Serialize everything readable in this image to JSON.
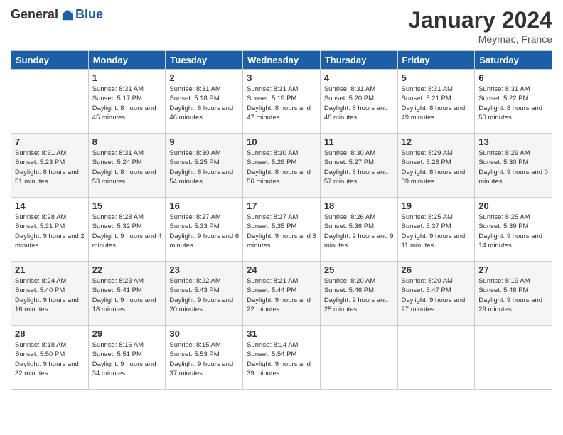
{
  "header": {
    "logo_general": "General",
    "logo_blue": "Blue",
    "month_title": "January 2024",
    "location": "Meymac, France"
  },
  "days_of_week": [
    "Sunday",
    "Monday",
    "Tuesday",
    "Wednesday",
    "Thursday",
    "Friday",
    "Saturday"
  ],
  "weeks": [
    [
      {
        "day": "",
        "sunrise": "",
        "sunset": "",
        "daylight": ""
      },
      {
        "day": "1",
        "sunrise": "Sunrise: 8:31 AM",
        "sunset": "Sunset: 5:17 PM",
        "daylight": "Daylight: 8 hours and 45 minutes."
      },
      {
        "day": "2",
        "sunrise": "Sunrise: 8:31 AM",
        "sunset": "Sunset: 5:18 PM",
        "daylight": "Daylight: 8 hours and 46 minutes."
      },
      {
        "day": "3",
        "sunrise": "Sunrise: 8:31 AM",
        "sunset": "Sunset: 5:19 PM",
        "daylight": "Daylight: 8 hours and 47 minutes."
      },
      {
        "day": "4",
        "sunrise": "Sunrise: 8:31 AM",
        "sunset": "Sunset: 5:20 PM",
        "daylight": "Daylight: 8 hours and 48 minutes."
      },
      {
        "day": "5",
        "sunrise": "Sunrise: 8:31 AM",
        "sunset": "Sunset: 5:21 PM",
        "daylight": "Daylight: 8 hours and 49 minutes."
      },
      {
        "day": "6",
        "sunrise": "Sunrise: 8:31 AM",
        "sunset": "Sunset: 5:22 PM",
        "daylight": "Daylight: 8 hours and 50 minutes."
      }
    ],
    [
      {
        "day": "7",
        "sunrise": "Sunrise: 8:31 AM",
        "sunset": "Sunset: 5:23 PM",
        "daylight": "Daylight: 8 hours and 51 minutes."
      },
      {
        "day": "8",
        "sunrise": "Sunrise: 8:31 AM",
        "sunset": "Sunset: 5:24 PM",
        "daylight": "Daylight: 8 hours and 53 minutes."
      },
      {
        "day": "9",
        "sunrise": "Sunrise: 8:30 AM",
        "sunset": "Sunset: 5:25 PM",
        "daylight": "Daylight: 8 hours and 54 minutes."
      },
      {
        "day": "10",
        "sunrise": "Sunrise: 8:30 AM",
        "sunset": "Sunset: 5:26 PM",
        "daylight": "Daylight: 8 hours and 56 minutes."
      },
      {
        "day": "11",
        "sunrise": "Sunrise: 8:30 AM",
        "sunset": "Sunset: 5:27 PM",
        "daylight": "Daylight: 8 hours and 57 minutes."
      },
      {
        "day": "12",
        "sunrise": "Sunrise: 8:29 AM",
        "sunset": "Sunset: 5:28 PM",
        "daylight": "Daylight: 8 hours and 59 minutes."
      },
      {
        "day": "13",
        "sunrise": "Sunrise: 8:29 AM",
        "sunset": "Sunset: 5:30 PM",
        "daylight": "Daylight: 9 hours and 0 minutes."
      }
    ],
    [
      {
        "day": "14",
        "sunrise": "Sunrise: 8:28 AM",
        "sunset": "Sunset: 5:31 PM",
        "daylight": "Daylight: 9 hours and 2 minutes."
      },
      {
        "day": "15",
        "sunrise": "Sunrise: 8:28 AM",
        "sunset": "Sunset: 5:32 PM",
        "daylight": "Daylight: 9 hours and 4 minutes."
      },
      {
        "day": "16",
        "sunrise": "Sunrise: 8:27 AM",
        "sunset": "Sunset: 5:33 PM",
        "daylight": "Daylight: 9 hours and 6 minutes."
      },
      {
        "day": "17",
        "sunrise": "Sunrise: 8:27 AM",
        "sunset": "Sunset: 5:35 PM",
        "daylight": "Daylight: 9 hours and 8 minutes."
      },
      {
        "day": "18",
        "sunrise": "Sunrise: 8:26 AM",
        "sunset": "Sunset: 5:36 PM",
        "daylight": "Daylight: 9 hours and 9 minutes."
      },
      {
        "day": "19",
        "sunrise": "Sunrise: 8:25 AM",
        "sunset": "Sunset: 5:37 PM",
        "daylight": "Daylight: 9 hours and 11 minutes."
      },
      {
        "day": "20",
        "sunrise": "Sunrise: 8:25 AM",
        "sunset": "Sunset: 5:39 PM",
        "daylight": "Daylight: 9 hours and 14 minutes."
      }
    ],
    [
      {
        "day": "21",
        "sunrise": "Sunrise: 8:24 AM",
        "sunset": "Sunset: 5:40 PM",
        "daylight": "Daylight: 9 hours and 16 minutes."
      },
      {
        "day": "22",
        "sunrise": "Sunrise: 8:23 AM",
        "sunset": "Sunset: 5:41 PM",
        "daylight": "Daylight: 9 hours and 18 minutes."
      },
      {
        "day": "23",
        "sunrise": "Sunrise: 8:22 AM",
        "sunset": "Sunset: 5:43 PM",
        "daylight": "Daylight: 9 hours and 20 minutes."
      },
      {
        "day": "24",
        "sunrise": "Sunrise: 8:21 AM",
        "sunset": "Sunset: 5:44 PM",
        "daylight": "Daylight: 9 hours and 22 minutes."
      },
      {
        "day": "25",
        "sunrise": "Sunrise: 8:20 AM",
        "sunset": "Sunset: 5:46 PM",
        "daylight": "Daylight: 9 hours and 25 minutes."
      },
      {
        "day": "26",
        "sunrise": "Sunrise: 8:20 AM",
        "sunset": "Sunset: 5:47 PM",
        "daylight": "Daylight: 9 hours and 27 minutes."
      },
      {
        "day": "27",
        "sunrise": "Sunrise: 8:19 AM",
        "sunset": "Sunset: 5:48 PM",
        "daylight": "Daylight: 9 hours and 29 minutes."
      }
    ],
    [
      {
        "day": "28",
        "sunrise": "Sunrise: 8:18 AM",
        "sunset": "Sunset: 5:50 PM",
        "daylight": "Daylight: 9 hours and 32 minutes."
      },
      {
        "day": "29",
        "sunrise": "Sunrise: 8:16 AM",
        "sunset": "Sunset: 5:51 PM",
        "daylight": "Daylight: 9 hours and 34 minutes."
      },
      {
        "day": "30",
        "sunrise": "Sunrise: 8:15 AM",
        "sunset": "Sunset: 5:53 PM",
        "daylight": "Daylight: 9 hours and 37 minutes."
      },
      {
        "day": "31",
        "sunrise": "Sunrise: 8:14 AM",
        "sunset": "Sunset: 5:54 PM",
        "daylight": "Daylight: 9 hours and 39 minutes."
      },
      {
        "day": "",
        "sunrise": "",
        "sunset": "",
        "daylight": ""
      },
      {
        "day": "",
        "sunrise": "",
        "sunset": "",
        "daylight": ""
      },
      {
        "day": "",
        "sunrise": "",
        "sunset": "",
        "daylight": ""
      }
    ]
  ]
}
